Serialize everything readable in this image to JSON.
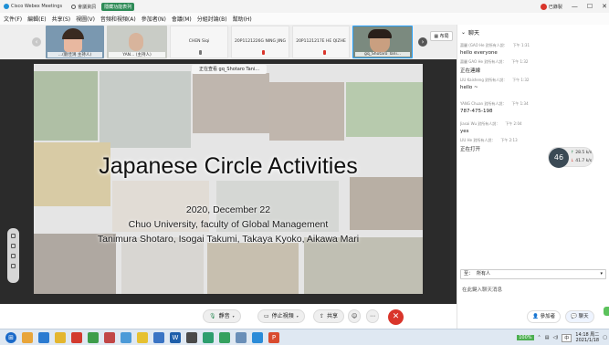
{
  "titlebar": {
    "app_name": "Cisco Webex Meetings",
    "meeting_info": "會議資訊",
    "hide_menubar": "隱藏功能表列",
    "recording_label": "已錄製"
  },
  "menu": [
    "文件(F)",
    "編輯(E)",
    "共享(S)",
    "視圖(V)",
    "音頻和視頻(A)",
    "參加者(N)",
    "會議(M)",
    "分組討論(B)",
    "幫助(H)"
  ],
  "participants": [
    {
      "name": "...(劉佳鴻 主持人)",
      "kind": "video"
    },
    {
      "name": "YAN... (主持人)",
      "kind": "video"
    },
    {
      "name": "CHEN Siqi",
      "kind": "blank"
    },
    {
      "name": "20P1121226G NING JING",
      "kind": "blank"
    },
    {
      "name": "20P1121217E HE QIZHE",
      "kind": "blank"
    },
    {
      "name": "gq_Shotaro Tani...",
      "kind": "video"
    }
  ],
  "layout_button": "布局",
  "viewing_banner": "正在查看 gq_Shotaro Tani...",
  "slide": {
    "title": "Japanese Circle Activities",
    "date": "2020, December 22",
    "org": "Chuo University, faculty of Global Management",
    "authors": "Tanimura Shotaro, Isogai Takumi, Takaya Kyoko, Aikawa Mari"
  },
  "controls": {
    "mute": "靜音",
    "stop_video": "停止視頻",
    "share": "共享",
    "participants": "參加者",
    "chat": "聊天"
  },
  "chat": {
    "title": "聊天",
    "messages": [
      {
        "from": "蕭麗 (GAO He 對所有人說：",
        "time": "下午 1:31",
        "text": "hello everyone"
      },
      {
        "from": "蕭麗 GAO He 對所有人說：",
        "time": "下午 1:32",
        "text": "正在連線"
      },
      {
        "from": "LIU Kaisheng 對所有人說：",
        "time": "下午 1:32",
        "text": "hello ~"
      },
      {
        "from": "YANG Chuan 對所有人說：",
        "time": "下午 1:34",
        "text": "787-475-198"
      },
      {
        "from": "Jiasai Wu 對所有人說：",
        "time": "下午 2:04",
        "text": "yes"
      },
      {
        "from": "LIU He 對所有人說：",
        "time": "下午 2:13",
        "text": "正在打开"
      }
    ],
    "recipient_label": "至：",
    "recipient_value": "所有人",
    "input_placeholder": "在此鍵入聊天消息"
  },
  "network_widget": {
    "percent": "46",
    "upload": "28.5",
    "upload_unit": "k/s",
    "download": "41.7",
    "download_unit": "k/s"
  },
  "taskbar": {
    "battery": "100%",
    "ime": "中",
    "time": "14:18 周二",
    "date": "2021/1/18"
  },
  "colors": {
    "accent_red": "#d9352b",
    "webex_green": "#2e8b57",
    "stage_bg": "#2b2b2b"
  }
}
